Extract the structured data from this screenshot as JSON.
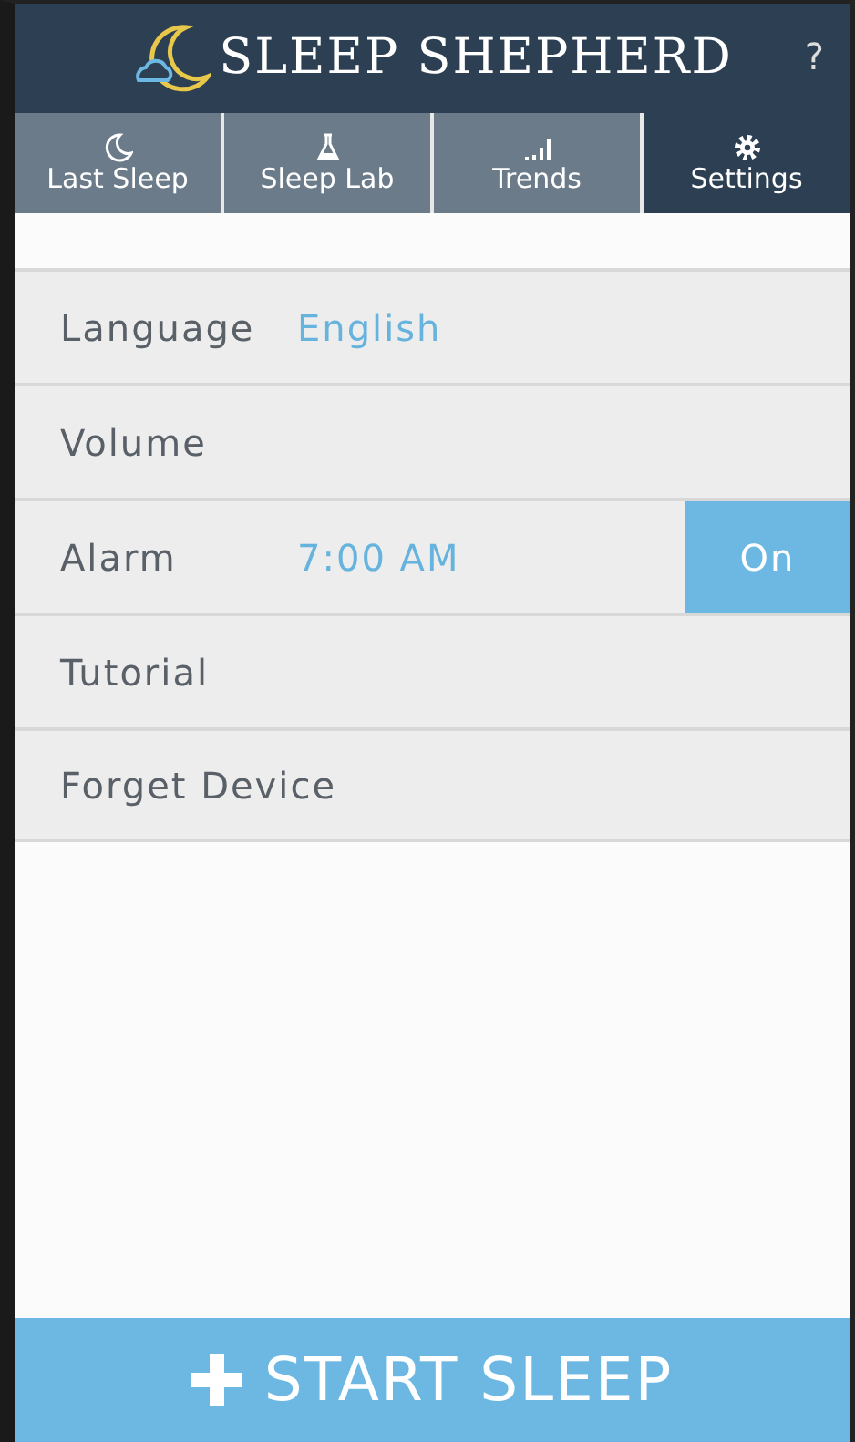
{
  "header": {
    "title": "SLEEP SHEPHERD",
    "help": "?"
  },
  "tabs": [
    {
      "label": "Last Sleep",
      "selected": false
    },
    {
      "label": "Sleep Lab",
      "selected": false
    },
    {
      "label": "Trends",
      "selected": false
    },
    {
      "label": "Settings",
      "selected": true
    }
  ],
  "settings": [
    {
      "label": "Language",
      "kind": "value",
      "value": "English"
    },
    {
      "label": "Volume",
      "kind": "plain"
    },
    {
      "label": "Alarm",
      "kind": "toggle",
      "value": "7:00 AM",
      "toggle": "On",
      "on": true
    },
    {
      "label": "Tutorial",
      "kind": "plain"
    },
    {
      "label": "Forget Device",
      "kind": "plain"
    }
  ],
  "start_button": {
    "label": "START SLEEP"
  }
}
